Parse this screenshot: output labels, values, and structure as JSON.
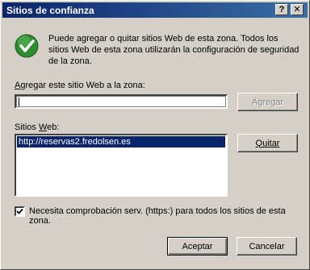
{
  "window": {
    "title": "Sitios de confianza",
    "help_label": "?",
    "close_label": "✕"
  },
  "info": {
    "icon": "check-icon",
    "text": "Puede agregar o quitar sitios Web de esta zona.  Todos los sitios Web de esta zona utilizarán la configuración de seguridad de la zona."
  },
  "add_site": {
    "label_accel": "A",
    "label_rest": "gregar este sitio Web a la zona:",
    "value": "",
    "add_button": "Agregar"
  },
  "sites": {
    "label_pre": "Sitios ",
    "label_accel": "W",
    "label_post": "eb:",
    "items": [
      "http://reservas2.fredolsen.es"
    ],
    "remove_button": "Quitar"
  },
  "https_check": {
    "checked": true,
    "label": "Necesita comprobación serv. (https:) para todos los sitios de esta zona."
  },
  "footer": {
    "ok_label": "Aceptar",
    "cancel_label": "Cancelar"
  },
  "colors": {
    "title_bar": "#0a246a",
    "dialog_bg": "#d4d0c8",
    "selection": "#0a246a",
    "check_green": "#2e8b2e"
  }
}
